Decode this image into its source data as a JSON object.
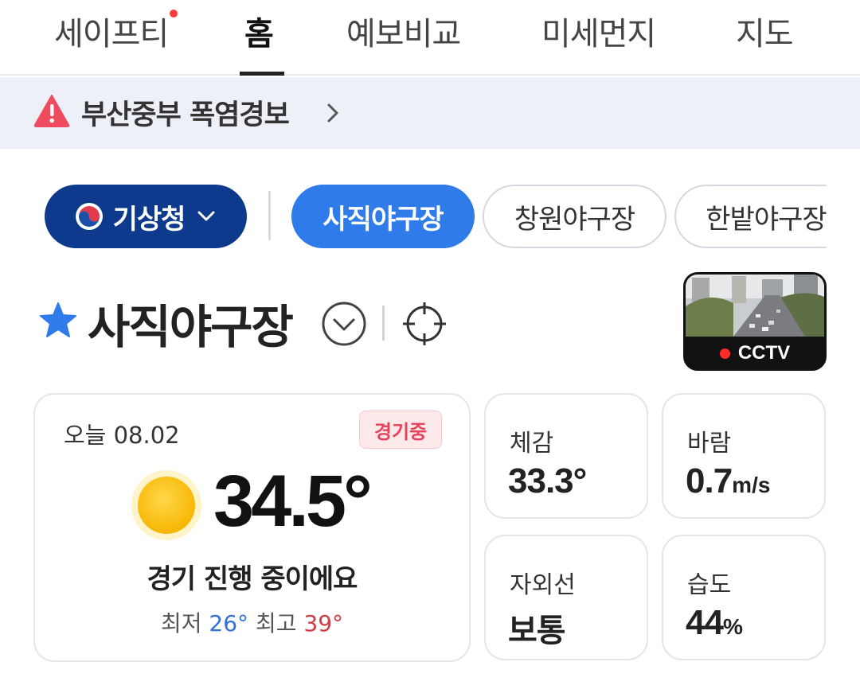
{
  "tabs": [
    {
      "label": "세이프티",
      "has_dot": true
    },
    {
      "label": "홈",
      "active": true
    },
    {
      "label": "예보비교"
    },
    {
      "label": "미세먼지"
    },
    {
      "label": "지도"
    }
  ],
  "alert": {
    "text": "부산중부 폭염경보",
    "icon": "warning-triangle-icon"
  },
  "source_chip": {
    "label": "기상청"
  },
  "location_chips": [
    {
      "label": "사직야구장",
      "active": true
    },
    {
      "label": "창원야구장"
    },
    {
      "label": "한밭야구장"
    }
  ],
  "location": {
    "title": "사직야구장",
    "favorite": true
  },
  "cctv": {
    "label": "CCTV"
  },
  "today": {
    "date_label": "오늘 08.02",
    "badge": "경기중",
    "temperature": "34.5°",
    "summary": "경기 진행 중이에요",
    "min_label": "최저",
    "min_value": "26°",
    "max_label": "최고",
    "max_value": "39°"
  },
  "stats": {
    "feels_like": {
      "label": "체감",
      "value": "33.3°"
    },
    "wind": {
      "label": "바람",
      "value": "0.7",
      "unit": "m/s"
    },
    "uv": {
      "label": "자외선",
      "value": "보통"
    },
    "humidity": {
      "label": "습도",
      "value": "44",
      "unit": "%"
    }
  },
  "colors": {
    "accent_blue": "#2f7bea",
    "source_navy": "#0d3a8c",
    "alert_red": "#e8415a",
    "low_temp": "#2f6fd6",
    "high_temp": "#d23a46"
  }
}
